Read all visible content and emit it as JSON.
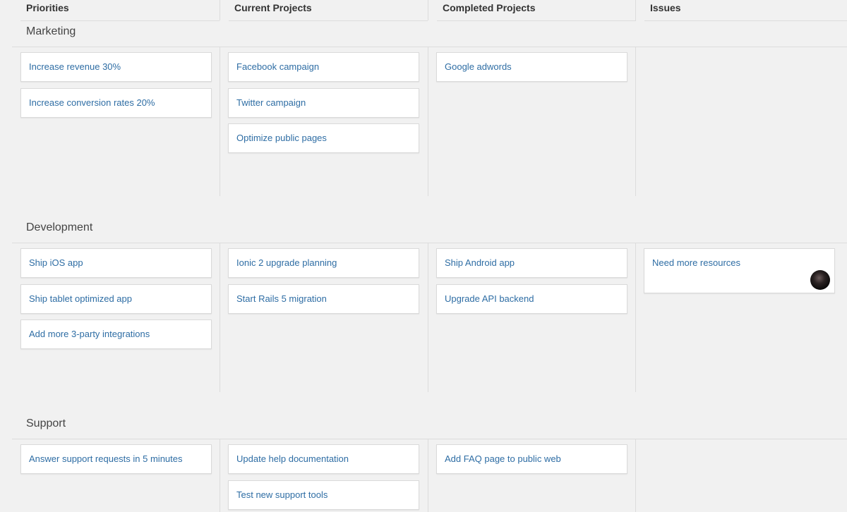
{
  "columns": [
    "Priorities",
    "Current Projects",
    "Completed Projects",
    "Issues"
  ],
  "groups": [
    {
      "name": "Marketing",
      "priorities": [
        "Increase revenue 30%",
        "Increase conversion rates 20%"
      ],
      "current": [
        "Facebook campaign",
        "Twitter campaign",
        "Optimize public pages"
      ],
      "completed": [
        "Google adwords"
      ],
      "issues": []
    },
    {
      "name": "Development",
      "priorities": [
        "Ship iOS app",
        "Ship tablet optimized app",
        "Add more 3-party integrations"
      ],
      "current": [
        "Ionic 2 upgrade planning",
        "Start Rails 5 migration"
      ],
      "completed": [
        "Ship Android app",
        "Upgrade API backend"
      ],
      "issues": [
        "Need more resources"
      ]
    },
    {
      "name": "Support",
      "priorities": [
        "Answer support requests in 5 minutes"
      ],
      "current": [
        "Update help documentation",
        "Test new support tools"
      ],
      "completed": [
        "Add FAQ page to public web"
      ],
      "issues": []
    }
  ]
}
